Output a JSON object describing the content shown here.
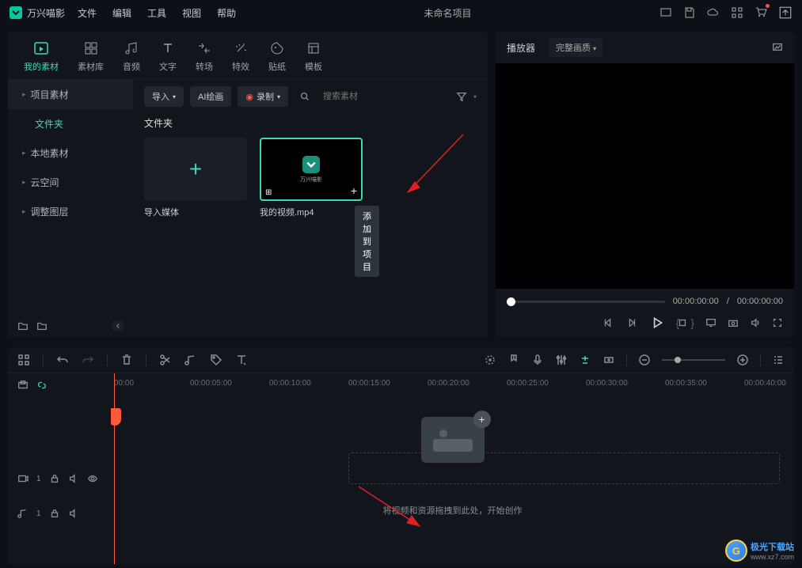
{
  "titlebar": {
    "app_name": "万兴喵影",
    "menus": [
      "文件",
      "编辑",
      "工具",
      "视图",
      "帮助"
    ],
    "project_title": "未命名项目"
  },
  "tabs": [
    {
      "id": "my-material",
      "label": "我的素材",
      "active": true
    },
    {
      "id": "material-lib",
      "label": "素材库"
    },
    {
      "id": "audio",
      "label": "音频"
    },
    {
      "id": "text",
      "label": "文字"
    },
    {
      "id": "transition",
      "label": "转场"
    },
    {
      "id": "effects",
      "label": "特效"
    },
    {
      "id": "sticker",
      "label": "贴纸"
    },
    {
      "id": "template",
      "label": "模板"
    }
  ],
  "sidebar": {
    "title": "项目素材",
    "active": "文件夹",
    "items": [
      "本地素材",
      "云空间",
      "调整图层"
    ]
  },
  "content_toolbar": {
    "import": "导入",
    "ai_paint": "AI绘画",
    "record": "录制",
    "search_placeholder": "搜索素材"
  },
  "folder_label": "文件夹",
  "thumbs": {
    "import_media": "导入媒体",
    "video_name": "我的视频.mp4",
    "video_caption": "万兴喵影",
    "tooltip": "添加到项目"
  },
  "preview": {
    "player_label": "播放器",
    "quality": "完整画质",
    "time_current": "00:00:00:00",
    "time_sep": "/",
    "time_total": "00:00:00:00"
  },
  "ruler": [
    "00:00",
    "00:00:05:00",
    "00:00:10:00",
    "00:00:15:00",
    "00:00:20:00",
    "00:00:25:00",
    "00:00:30:00",
    "00:00:35:00",
    "00:00:40:00"
  ],
  "tracks": {
    "video": "1",
    "audio": "1"
  },
  "drop_hint": "将视频和资源拖拽到此处，开始创作",
  "watermark": {
    "site": "极光下载站",
    "url": "www.xz7.com"
  }
}
